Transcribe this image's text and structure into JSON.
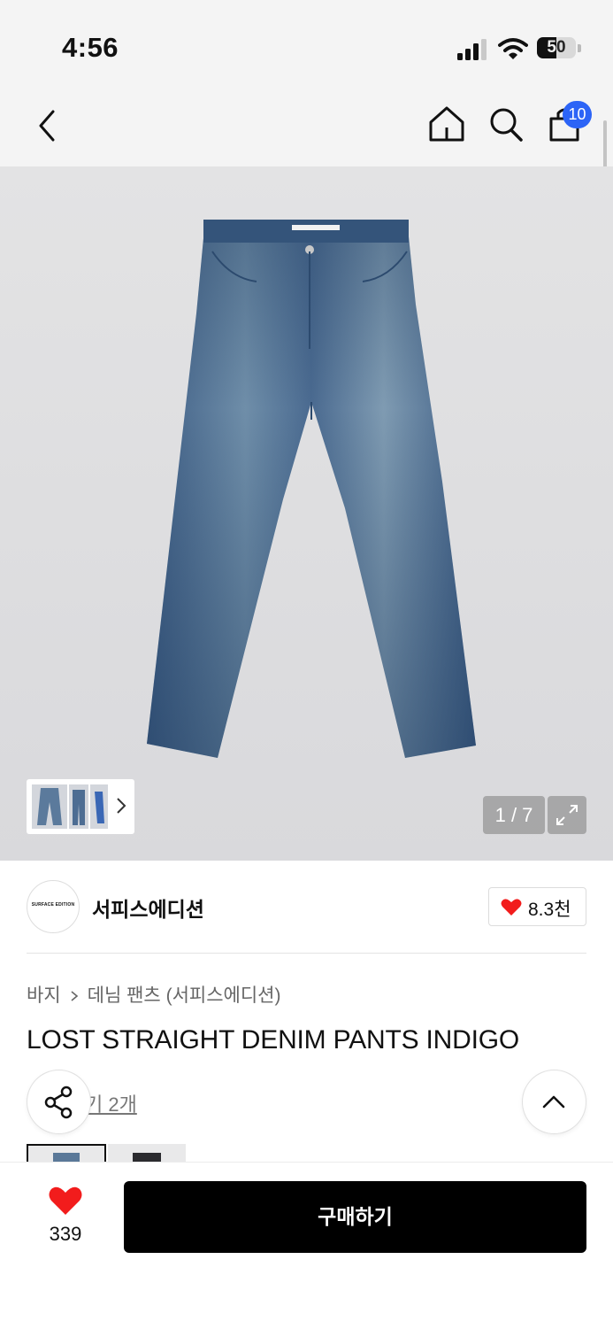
{
  "status_bar": {
    "time": "4:56",
    "battery": "50",
    "battery_level": 0.5
  },
  "header": {
    "cart_count": "10",
    "icons": [
      "back-icon",
      "home-icon",
      "search-icon",
      "cart-icon"
    ]
  },
  "gallery": {
    "counter": "1 / 7",
    "icons": [
      "expand-icon",
      "chevron-right-icon"
    ]
  },
  "brand": {
    "logo_text": "SURFACE EDITION",
    "name": "서피스에디션",
    "likes": "8.3천"
  },
  "breadcrumb": {
    "category": "바지",
    "subcategory": "데님 팬츠 (서피스에디션)"
  },
  "product": {
    "title": "LOST STRAIGHT DENIM PANTS INDIGO",
    "reviews_link": "기 2개"
  },
  "bottom_bar": {
    "wish_count": "339",
    "buy_label": "구매하기"
  },
  "colors": {
    "heart": "#f21c1c",
    "badge": "#2c64f6",
    "button": "#000000"
  }
}
